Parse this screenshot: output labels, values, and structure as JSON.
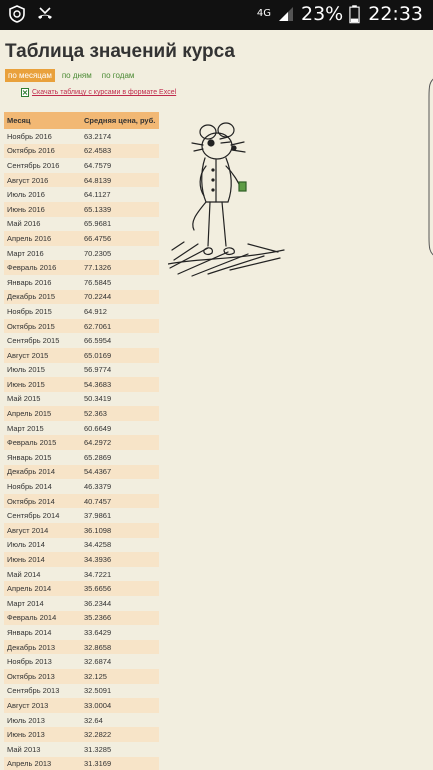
{
  "status_bar": {
    "network": "4G",
    "battery_percent": "23%",
    "time": "22:33"
  },
  "page": {
    "title": "Таблица значений курса",
    "tabs": [
      "по месяцам",
      "по дням",
      "по годам"
    ],
    "active_tab": 0,
    "download_label": "Скачать таблицу с курсами в формате Excel"
  },
  "table": {
    "headers": [
      "Месяц",
      "Средняя цена, руб."
    ],
    "rows": [
      [
        "Ноябрь 2016",
        "63.2174"
      ],
      [
        "Октябрь 2016",
        "62.4583"
      ],
      [
        "Сентябрь 2016",
        "64.7579"
      ],
      [
        "Август 2016",
        "64.8139"
      ],
      [
        "Июль 2016",
        "64.1127"
      ],
      [
        "Июнь 2016",
        "65.1339"
      ],
      [
        "Май 2016",
        "65.9681"
      ],
      [
        "Апрель 2016",
        "66.4756"
      ],
      [
        "Март 2016",
        "70.2305"
      ],
      [
        "Февраль 2016",
        "77.1326"
      ],
      [
        "Январь 2016",
        "76.5845"
      ],
      [
        "Декабрь 2015",
        "70.2244"
      ],
      [
        "Ноябрь 2015",
        "64.912"
      ],
      [
        "Октябрь 2015",
        "62.7061"
      ],
      [
        "Сентябрь 2015",
        "66.5954"
      ],
      [
        "Август 2015",
        "65.0169"
      ],
      [
        "Июль 2015",
        "56.9774"
      ],
      [
        "Июнь 2015",
        "54.3683"
      ],
      [
        "Май 2015",
        "50.3419"
      ],
      [
        "Апрель 2015",
        "52.363"
      ],
      [
        "Март 2015",
        "60.6649"
      ],
      [
        "Февраль 2015",
        "64.2972"
      ],
      [
        "Январь 2015",
        "65.2869"
      ],
      [
        "Декабрь 2014",
        "54.4367"
      ],
      [
        "Ноябрь 2014",
        "46.3379"
      ],
      [
        "Октябрь 2014",
        "40.7457"
      ],
      [
        "Сентябрь 2014",
        "37.9861"
      ],
      [
        "Август 2014",
        "36.1098"
      ],
      [
        "Июль 2014",
        "34.4258"
      ],
      [
        "Июнь 2014",
        "34.3936"
      ],
      [
        "Май 2014",
        "34.7221"
      ],
      [
        "Апрель 2014",
        "35.6656"
      ],
      [
        "Март 2014",
        "36.2344"
      ],
      [
        "Февраль 2014",
        "35.2366"
      ],
      [
        "Январь 2014",
        "33.6429"
      ],
      [
        "Декабрь 2013",
        "32.8658"
      ],
      [
        "Ноябрь 2013",
        "32.6874"
      ],
      [
        "Октябрь 2013",
        "32.125"
      ],
      [
        "Сентябрь 2013",
        "32.5091"
      ],
      [
        "Август 2013",
        "33.0004"
      ],
      [
        "Июль 2013",
        "32.64"
      ],
      [
        "Июнь 2013",
        "32.2822"
      ],
      [
        "Май 2013",
        "31.3285"
      ],
      [
        "Апрель 2013",
        "31.3169"
      ]
    ]
  },
  "icons": {
    "status_left": [
      "shield-icon",
      "missed-call-icon"
    ],
    "status_right": [
      "signal-icon",
      "battery-icon"
    ],
    "download": "excel-file-icon",
    "illustration": "cartoon-mouse-illustration"
  },
  "colors": {
    "background": "#f2eedf",
    "table_header": "#f2b874",
    "table_stripe": "#f7e4c8",
    "active_tab": "#e9a13c",
    "link_green": "#4a8a33",
    "download_link": "#c02a4c"
  }
}
